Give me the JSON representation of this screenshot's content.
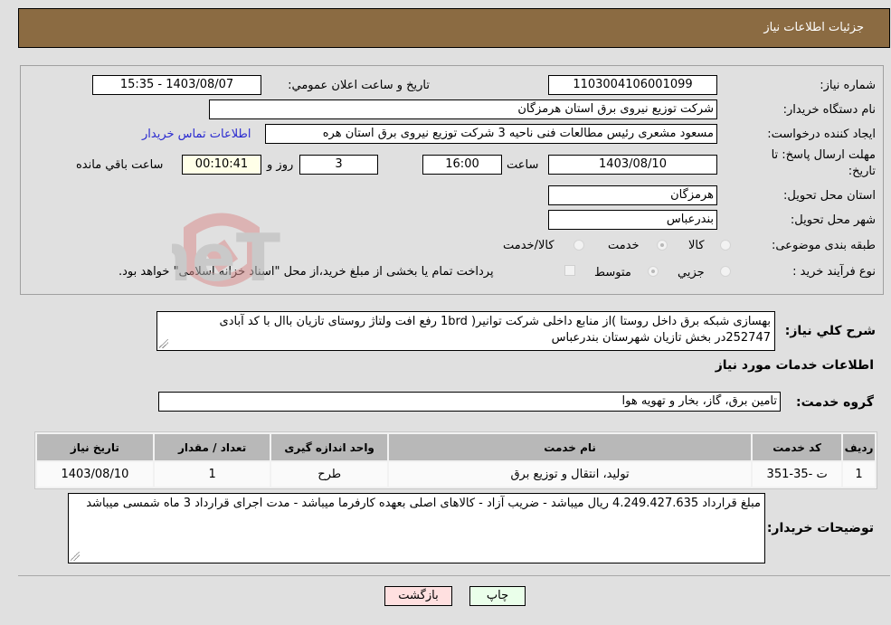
{
  "header": {
    "title": "جزئيات اطلاعات نياز"
  },
  "form": {
    "need_number": {
      "label": "شماره نياز:",
      "value": "1103004106001099"
    },
    "announce_datetime": {
      "label": "تاريخ و ساعت اعلان عمومي:",
      "value": "1403/08/07 - 15:35"
    },
    "buyer_org": {
      "label": "نام دستگاه خريدار:",
      "value": "شرکت توزيع نيروی برق استان هرمزگان"
    },
    "requester": {
      "label": "ايجاد کننده درخواست:",
      "value": "مسعود مشعری رئيس مطالعات فنی ناحيه 3 شرکت توزيع نيروی برق استان هره",
      "contact_link": "اطلاعات تماس خريدار"
    },
    "deadline": {
      "label_line1": "مهلت ارسال پاسخ: تا",
      "label_line2": "تاريخ:",
      "date": "1403/08/10",
      "time_label": "ساعت",
      "time": "16:00",
      "days": "3",
      "days_label": "روز و",
      "remaining": "00:10:41",
      "remaining_label": "ساعت باقي مانده"
    },
    "delivery_province": {
      "label": "استان محل تحويل:",
      "value": "هرمزگان"
    },
    "delivery_city": {
      "label": "شهر محل تحويل:",
      "value": "بندرعباس"
    },
    "category": {
      "label": "طبقه بندی موضوعی:",
      "options": [
        {
          "label": "کالا",
          "checked": false
        },
        {
          "label": "خدمت",
          "checked": true
        },
        {
          "label": "کالا/خدمت",
          "checked": false
        }
      ]
    },
    "purchase_type": {
      "label": "نوع فرآيند خريد :",
      "options": [
        {
          "label": "جزيي",
          "checked": false
        },
        {
          "label": "متوسط",
          "checked": true
        }
      ],
      "treasury_checkbox_label": "پرداخت تمام يا بخشی از مبلغ خريد،از محل \"اسناد خزانه اسلامی\" خواهد بود.",
      "treasury_checked": false
    }
  },
  "description": {
    "label": "شرح کلي نياز:",
    "value": "بهسازی شبکه برق داخل روستا )از منابع داخلی شرکت توانير( 1brd رفع افت ولتاژ روستای تازيان باال با کد آبادی 252747در بخش تازيان شهرستان بندرعباس"
  },
  "services_section": {
    "title": "اطلاعات خدمات مورد نياز",
    "group_label": "گروه خدمت:",
    "group_value": "تامين برق، گاز، بخار و تهويه هوا"
  },
  "table": {
    "headers": [
      "رديف",
      "کد خدمت",
      "نام خدمت",
      "واحد اندازه گيری",
      "تعداد / مقدار",
      "تاريخ نياز"
    ],
    "rows": [
      [
        "1",
        "ت -35-351",
        "توليد، انتقال و توزيع برق",
        "طرح",
        "1",
        "1403/08/10"
      ]
    ]
  },
  "buyer_notes": {
    "label": "توضيحات خريدار:",
    "value": "مبلغ قرارداد 4.249.427.635 ريال ميباشد - ضريب آزاد - کالاهای اصلی بعهده کارفرما ميباشد - مدت اجرای قرارداد 3 ماه شمسی ميباشد"
  },
  "buttons": {
    "print": "چاپ",
    "back": "بازگشت"
  },
  "watermark": {
    "text": "AriaTender.neT"
  },
  "colors": {
    "header_bg": "#8b6b42",
    "print_bg": "#eaffea",
    "back_bg": "#ffe0e0",
    "link": "#2a2ad0"
  }
}
